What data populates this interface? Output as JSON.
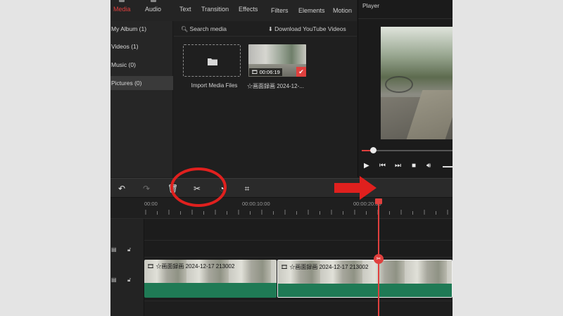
{
  "tabs": [
    {
      "label": "Media",
      "active": true
    },
    {
      "label": "Audio",
      "active": false
    },
    {
      "label": "Text",
      "active": false
    },
    {
      "label": "Transition",
      "active": false
    },
    {
      "label": "Effects",
      "active": false
    },
    {
      "label": "Filters",
      "active": false
    },
    {
      "label": "Elements",
      "active": false
    },
    {
      "label": "Motion",
      "active": false
    }
  ],
  "sidebar": {
    "items": [
      {
        "label": "My Album (1)",
        "selected": false
      },
      {
        "label": "Videos (1)",
        "selected": false
      },
      {
        "label": "Music (0)",
        "selected": false
      },
      {
        "label": "Pictures (0)",
        "selected": true
      }
    ]
  },
  "media": {
    "search_label": "Search media",
    "download_label": "Download YouTube Videos",
    "import_label": "Import Media Files",
    "item": {
      "duration": "00:06:19",
      "name": "☆画面録画 2024-12-..."
    }
  },
  "player": {
    "title": "Player",
    "progress": 0.12
  },
  "timeline": {
    "ruler_labels": [
      "00:00",
      "00:00:10:00",
      "00:00:20:00"
    ],
    "clips": [
      {
        "label": "☆画面録画 2024-12-17 213002",
        "selected": false
      },
      {
        "label": "☆画面録画 2024-12-17 213002",
        "selected": true
      }
    ]
  },
  "icons": {
    "folder": "folder-icon",
    "search": "search-icon",
    "download": "download-icon",
    "undo": "undo-icon",
    "redo": "redo-icon",
    "delete": "trash-icon",
    "split": "scissors-icon",
    "speed": "speed-icon",
    "crop": "crop-icon",
    "play": "play-icon",
    "prev": "skip-back-icon",
    "next": "skip-forward-icon",
    "stop": "stop-icon",
    "volume": "volume-icon"
  },
  "colors": {
    "accent": "#e0403e",
    "audio_track": "#1f7a55",
    "annotation": "#e0201e"
  }
}
